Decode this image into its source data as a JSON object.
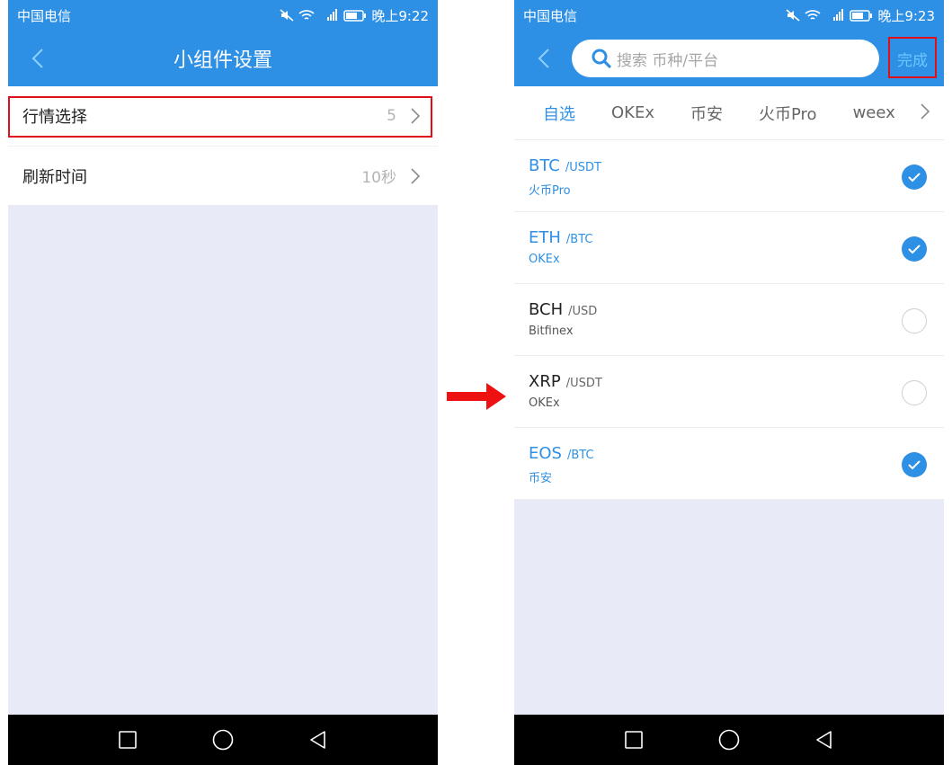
{
  "left": {
    "status": {
      "carrier": "中国电信",
      "time": "晚上9:22"
    },
    "header": {
      "title": "小组件设置"
    },
    "rows": [
      {
        "label": "行情选择",
        "value": "5"
      },
      {
        "label": "刷新时间",
        "value": "10秒"
      }
    ]
  },
  "right": {
    "status": {
      "carrier": "中国电信",
      "time": "晚上9:23"
    },
    "search": {
      "placeholder": "搜索 币种/平台"
    },
    "done_label": "完成",
    "tabs": [
      "自选",
      "OKEx",
      "币安",
      "火币Pro",
      "weex"
    ],
    "active_tab": "自选",
    "coins": [
      {
        "symbol": "BTC",
        "quote": "/USDT",
        "exchange": "火币Pro",
        "selected": true
      },
      {
        "symbol": "ETH",
        "quote": "/BTC",
        "exchange": "OKEx",
        "selected": true
      },
      {
        "symbol": "BCH",
        "quote": "/USD",
        "exchange": "Bitfinex",
        "selected": false
      },
      {
        "symbol": "XRP",
        "quote": "/USDT",
        "exchange": "OKEx",
        "selected": false
      },
      {
        "symbol": "EOS",
        "quote": "/BTC",
        "exchange": "币安",
        "selected": true
      }
    ]
  },
  "colors": {
    "primary": "#2e90e5",
    "highlight": "#e0101a",
    "background": "#e9eaf7"
  },
  "icons": [
    "back-icon",
    "chevron-right-icon",
    "search-icon",
    "check-icon",
    "square-nav-icon",
    "circle-nav-icon",
    "triangle-back-nav-icon",
    "arrow-right-icon"
  ]
}
